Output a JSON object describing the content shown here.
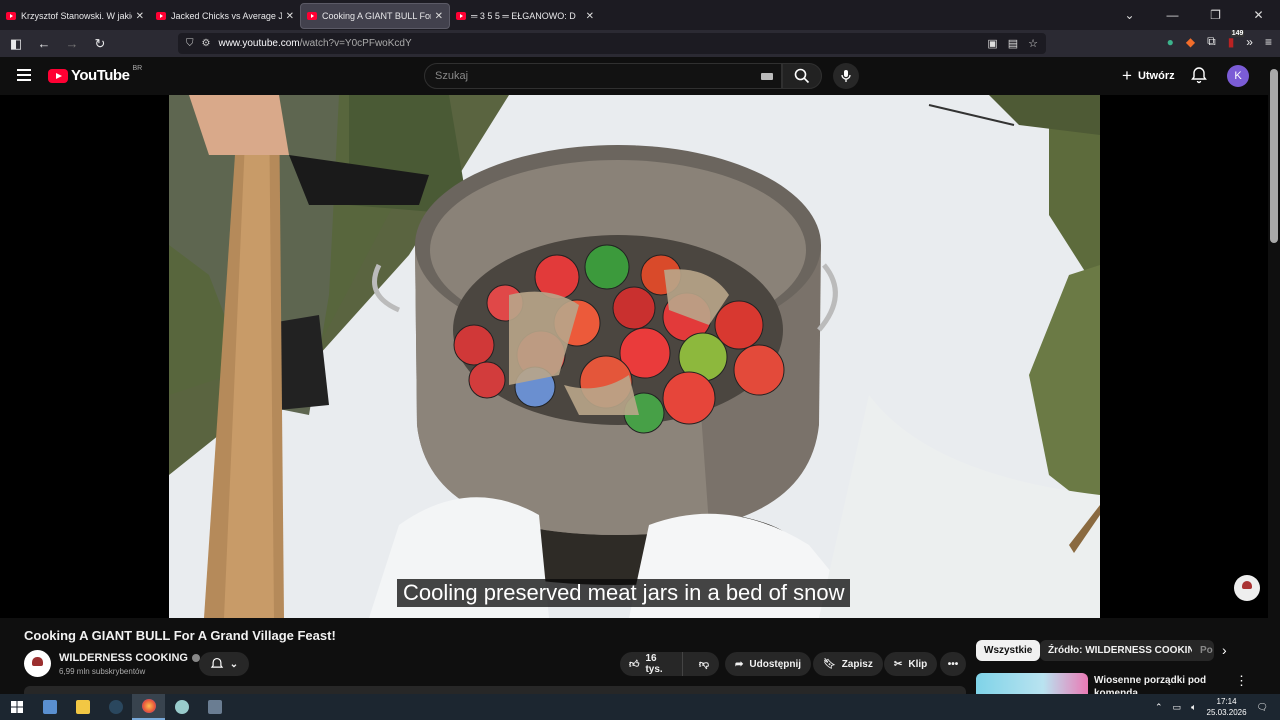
{
  "browser": {
    "tabs": [
      {
        "title": "Krzysztof Stanowski. W jakiej sp",
        "active": false
      },
      {
        "title": "Jacked Chicks vs Average Joes |",
        "active": false
      },
      {
        "title": "Cooking A GIANT BULL For A G",
        "active": true
      },
      {
        "title": "═ 3 5 5 ═ EŁGANOWO: D",
        "active": false
      }
    ],
    "url": {
      "host": "www.youtube.com",
      "path": "/watch?v=Y0cPFwoKcdY"
    },
    "extension_badge": "149"
  },
  "youtube": {
    "logo_text": "YouTube",
    "country_code": "BR",
    "search_placeholder": "Szukaj",
    "create_label": "Utwórz",
    "avatar_initial": "K"
  },
  "video": {
    "caption": "Cooling preserved meat jars in a bed of snow",
    "title": "Cooking A GIANT BULL For A Grand Village Feast!",
    "channel": {
      "name": "WILDERNESS COOKING",
      "subscribers": "6,99 mln subskrybentów"
    },
    "likes": "16 tys.",
    "share_label": "Udostępnij",
    "save_label": "Zapisz",
    "clip_label": "Klip"
  },
  "sidebar": {
    "chips": [
      {
        "label": "Wszystkie",
        "active": true
      },
      {
        "label": "Źródło: WILDERNESS COOKING",
        "active": false
      },
      {
        "label": "Po",
        "active": false
      }
    ],
    "recommendation": {
      "title": "Wiosenne porządki pod komendą"
    }
  },
  "taskbar": {
    "time": "17:14",
    "date": "25.03.2026"
  },
  "colors": {
    "youtube_red": "#ff0033",
    "avatar_bg": "#7b5cd6",
    "background": "#0f0f0f"
  }
}
